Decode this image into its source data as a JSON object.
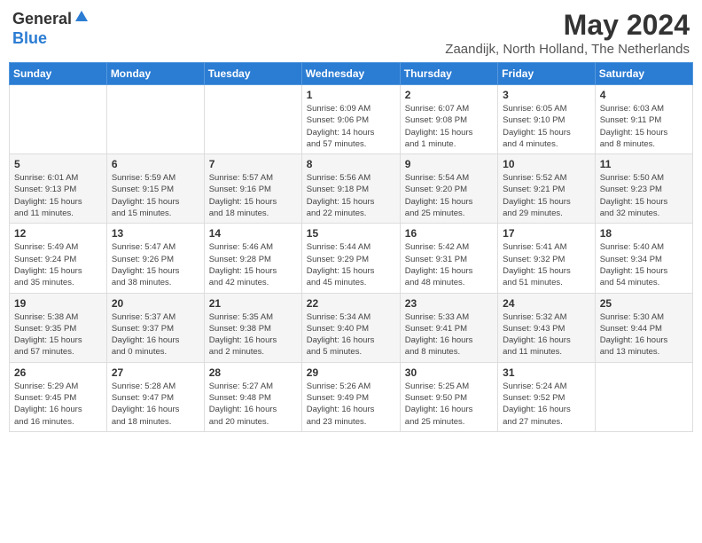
{
  "header": {
    "logo_general": "General",
    "logo_blue": "Blue",
    "month_title": "May 2024",
    "location": "Zaandijk, North Holland, The Netherlands"
  },
  "days_of_week": [
    "Sunday",
    "Monday",
    "Tuesday",
    "Wednesday",
    "Thursday",
    "Friday",
    "Saturday"
  ],
  "weeks": [
    [
      {
        "day": "",
        "info": ""
      },
      {
        "day": "",
        "info": ""
      },
      {
        "day": "",
        "info": ""
      },
      {
        "day": "1",
        "info": "Sunrise: 6:09 AM\nSunset: 9:06 PM\nDaylight: 14 hours\nand 57 minutes."
      },
      {
        "day": "2",
        "info": "Sunrise: 6:07 AM\nSunset: 9:08 PM\nDaylight: 15 hours\nand 1 minute."
      },
      {
        "day": "3",
        "info": "Sunrise: 6:05 AM\nSunset: 9:10 PM\nDaylight: 15 hours\nand 4 minutes."
      },
      {
        "day": "4",
        "info": "Sunrise: 6:03 AM\nSunset: 9:11 PM\nDaylight: 15 hours\nand 8 minutes."
      }
    ],
    [
      {
        "day": "5",
        "info": "Sunrise: 6:01 AM\nSunset: 9:13 PM\nDaylight: 15 hours\nand 11 minutes."
      },
      {
        "day": "6",
        "info": "Sunrise: 5:59 AM\nSunset: 9:15 PM\nDaylight: 15 hours\nand 15 minutes."
      },
      {
        "day": "7",
        "info": "Sunrise: 5:57 AM\nSunset: 9:16 PM\nDaylight: 15 hours\nand 18 minutes."
      },
      {
        "day": "8",
        "info": "Sunrise: 5:56 AM\nSunset: 9:18 PM\nDaylight: 15 hours\nand 22 minutes."
      },
      {
        "day": "9",
        "info": "Sunrise: 5:54 AM\nSunset: 9:20 PM\nDaylight: 15 hours\nand 25 minutes."
      },
      {
        "day": "10",
        "info": "Sunrise: 5:52 AM\nSunset: 9:21 PM\nDaylight: 15 hours\nand 29 minutes."
      },
      {
        "day": "11",
        "info": "Sunrise: 5:50 AM\nSunset: 9:23 PM\nDaylight: 15 hours\nand 32 minutes."
      }
    ],
    [
      {
        "day": "12",
        "info": "Sunrise: 5:49 AM\nSunset: 9:24 PM\nDaylight: 15 hours\nand 35 minutes."
      },
      {
        "day": "13",
        "info": "Sunrise: 5:47 AM\nSunset: 9:26 PM\nDaylight: 15 hours\nand 38 minutes."
      },
      {
        "day": "14",
        "info": "Sunrise: 5:46 AM\nSunset: 9:28 PM\nDaylight: 15 hours\nand 42 minutes."
      },
      {
        "day": "15",
        "info": "Sunrise: 5:44 AM\nSunset: 9:29 PM\nDaylight: 15 hours\nand 45 minutes."
      },
      {
        "day": "16",
        "info": "Sunrise: 5:42 AM\nSunset: 9:31 PM\nDaylight: 15 hours\nand 48 minutes."
      },
      {
        "day": "17",
        "info": "Sunrise: 5:41 AM\nSunset: 9:32 PM\nDaylight: 15 hours\nand 51 minutes."
      },
      {
        "day": "18",
        "info": "Sunrise: 5:40 AM\nSunset: 9:34 PM\nDaylight: 15 hours\nand 54 minutes."
      }
    ],
    [
      {
        "day": "19",
        "info": "Sunrise: 5:38 AM\nSunset: 9:35 PM\nDaylight: 15 hours\nand 57 minutes."
      },
      {
        "day": "20",
        "info": "Sunrise: 5:37 AM\nSunset: 9:37 PM\nDaylight: 16 hours\nand 0 minutes."
      },
      {
        "day": "21",
        "info": "Sunrise: 5:35 AM\nSunset: 9:38 PM\nDaylight: 16 hours\nand 2 minutes."
      },
      {
        "day": "22",
        "info": "Sunrise: 5:34 AM\nSunset: 9:40 PM\nDaylight: 16 hours\nand 5 minutes."
      },
      {
        "day": "23",
        "info": "Sunrise: 5:33 AM\nSunset: 9:41 PM\nDaylight: 16 hours\nand 8 minutes."
      },
      {
        "day": "24",
        "info": "Sunrise: 5:32 AM\nSunset: 9:43 PM\nDaylight: 16 hours\nand 11 minutes."
      },
      {
        "day": "25",
        "info": "Sunrise: 5:30 AM\nSunset: 9:44 PM\nDaylight: 16 hours\nand 13 minutes."
      }
    ],
    [
      {
        "day": "26",
        "info": "Sunrise: 5:29 AM\nSunset: 9:45 PM\nDaylight: 16 hours\nand 16 minutes."
      },
      {
        "day": "27",
        "info": "Sunrise: 5:28 AM\nSunset: 9:47 PM\nDaylight: 16 hours\nand 18 minutes."
      },
      {
        "day": "28",
        "info": "Sunrise: 5:27 AM\nSunset: 9:48 PM\nDaylight: 16 hours\nand 20 minutes."
      },
      {
        "day": "29",
        "info": "Sunrise: 5:26 AM\nSunset: 9:49 PM\nDaylight: 16 hours\nand 23 minutes."
      },
      {
        "day": "30",
        "info": "Sunrise: 5:25 AM\nSunset: 9:50 PM\nDaylight: 16 hours\nand 25 minutes."
      },
      {
        "day": "31",
        "info": "Sunrise: 5:24 AM\nSunset: 9:52 PM\nDaylight: 16 hours\nand 27 minutes."
      },
      {
        "day": "",
        "info": ""
      }
    ]
  ]
}
